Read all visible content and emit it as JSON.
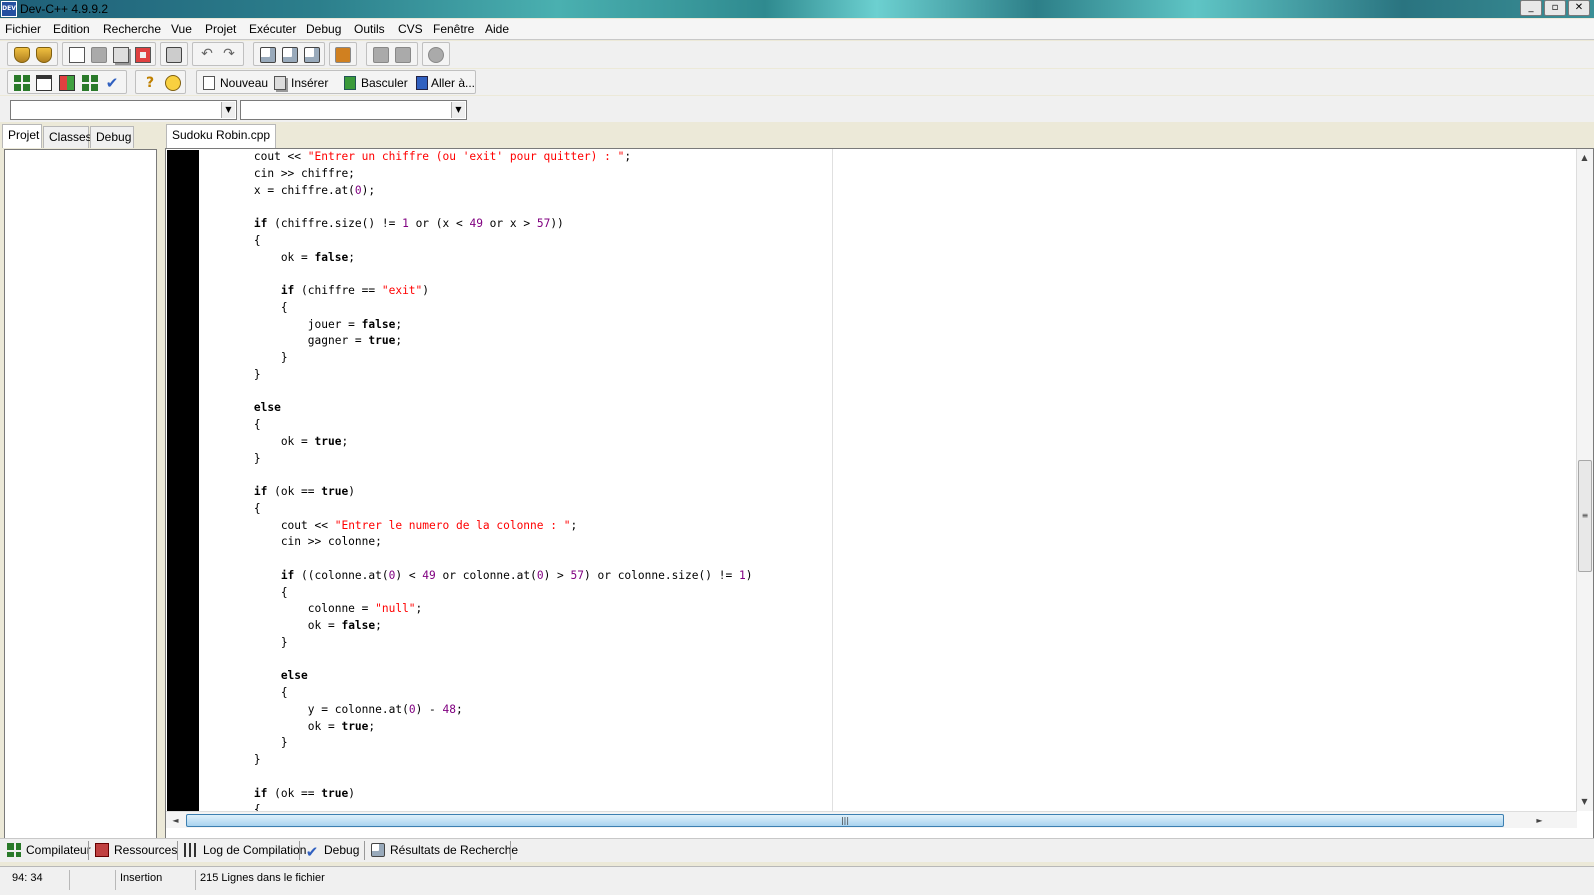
{
  "window": {
    "title": "Dev-C++ 4.9.9.2",
    "icon_label": "DEV",
    "minimize": "_",
    "maximize": "▫",
    "close": "✕"
  },
  "menu": [
    "Fichier",
    "Edition",
    "Recherche",
    "Vue",
    "Projet",
    "Exécuter",
    "Debug",
    "Outils",
    "CVS",
    "Fenêtre",
    "Aide"
  ],
  "toolbar": {
    "nouveau": "Nouveau",
    "inserer": "Insérer",
    "basculer": "Basculer",
    "aller": "Aller à..."
  },
  "combos": {
    "left_value": "",
    "right_value": "",
    "arrow": "▼"
  },
  "left_tabs": [
    "Projet",
    "Classes",
    "Debug"
  ],
  "file_tab": "Sudoku Robin.cpp",
  "code_lines": [
    [
      [
        "t",
        "        cout << "
      ],
      [
        "s",
        "\"Entrer un chiffre (ou 'exit' pour quitter) : \""
      ],
      [
        "t",
        ";"
      ]
    ],
    [
      [
        "t",
        "        cin >> chiffre;"
      ]
    ],
    [
      [
        "t",
        "        x = chiffre.at("
      ],
      [
        "n",
        "0"
      ],
      [
        "t",
        ");"
      ]
    ],
    [
      [
        "t",
        ""
      ]
    ],
    [
      [
        "k",
        "        if"
      ],
      [
        "t",
        " (chiffre.size() != "
      ],
      [
        "n",
        "1"
      ],
      [
        "t",
        " or (x < "
      ],
      [
        "n",
        "49"
      ],
      [
        "t",
        " or x > "
      ],
      [
        "n",
        "57"
      ],
      [
        "t",
        "))"
      ]
    ],
    [
      [
        "t",
        "        {"
      ]
    ],
    [
      [
        "t",
        "            ok = "
      ],
      [
        "k",
        "false"
      ],
      [
        "t",
        ";"
      ]
    ],
    [
      [
        "t",
        ""
      ]
    ],
    [
      [
        "k",
        "            if"
      ],
      [
        "t",
        " (chiffre == "
      ],
      [
        "s",
        "\"exit\""
      ],
      [
        "t",
        ")"
      ]
    ],
    [
      [
        "t",
        "            {"
      ]
    ],
    [
      [
        "t",
        "                jouer = "
      ],
      [
        "k",
        "false"
      ],
      [
        "t",
        ";"
      ]
    ],
    [
      [
        "t",
        "                gagner = "
      ],
      [
        "k",
        "true"
      ],
      [
        "t",
        ";"
      ]
    ],
    [
      [
        "t",
        "            }"
      ]
    ],
    [
      [
        "t",
        "        }"
      ]
    ],
    [
      [
        "t",
        ""
      ]
    ],
    [
      [
        "k",
        "        else"
      ]
    ],
    [
      [
        "t",
        "        {"
      ]
    ],
    [
      [
        "t",
        "            ok = "
      ],
      [
        "k",
        "true"
      ],
      [
        "t",
        ";"
      ]
    ],
    [
      [
        "t",
        "        }"
      ]
    ],
    [
      [
        "t",
        ""
      ]
    ],
    [
      [
        "k",
        "        if"
      ],
      [
        "t",
        " (ok == "
      ],
      [
        "k",
        "true"
      ],
      [
        "t",
        ")"
      ]
    ],
    [
      [
        "t",
        "        {"
      ]
    ],
    [
      [
        "t",
        "            cout << "
      ],
      [
        "s",
        "\"Entrer le numero de la colonne : \""
      ],
      [
        "t",
        ";"
      ]
    ],
    [
      [
        "t",
        "            cin >> colonne;"
      ]
    ],
    [
      [
        "t",
        ""
      ]
    ],
    [
      [
        "k",
        "            if"
      ],
      [
        "t",
        " ((colonne.at("
      ],
      [
        "n",
        "0"
      ],
      [
        "t",
        ") < "
      ],
      [
        "n",
        "49"
      ],
      [
        "t",
        " or colonne.at("
      ],
      [
        "n",
        "0"
      ],
      [
        "t",
        ") > "
      ],
      [
        "n",
        "57"
      ],
      [
        "t",
        ") or colonne.size() != "
      ],
      [
        "n",
        "1"
      ],
      [
        "t",
        ")"
      ]
    ],
    [
      [
        "t",
        "            {"
      ]
    ],
    [
      [
        "t",
        "                colonne = "
      ],
      [
        "s",
        "\"null\""
      ],
      [
        "t",
        ";"
      ]
    ],
    [
      [
        "t",
        "                ok = "
      ],
      [
        "k",
        "false"
      ],
      [
        "t",
        ";"
      ]
    ],
    [
      [
        "t",
        "            }"
      ]
    ],
    [
      [
        "t",
        ""
      ]
    ],
    [
      [
        "k",
        "            else"
      ]
    ],
    [
      [
        "t",
        "            {"
      ]
    ],
    [
      [
        "t",
        "                y = colonne.at("
      ],
      [
        "n",
        "0"
      ],
      [
        "t",
        ") - "
      ],
      [
        "n",
        "48"
      ],
      [
        "t",
        ";"
      ]
    ],
    [
      [
        "t",
        "                ok = "
      ],
      [
        "k",
        "true"
      ],
      [
        "t",
        ";"
      ]
    ],
    [
      [
        "t",
        "            }"
      ]
    ],
    [
      [
        "t",
        "        }"
      ]
    ],
    [
      [
        "t",
        ""
      ]
    ],
    [
      [
        "k",
        "        if"
      ],
      [
        "t",
        " (ok == "
      ],
      [
        "k",
        "true"
      ],
      [
        "t",
        ")"
      ]
    ],
    [
      [
        "t",
        "        {"
      ]
    ]
  ],
  "bottom_tabs": [
    "Compilateur",
    "Ressources",
    "Log de Compilation",
    "Debug",
    "Résultats de Recherche"
  ],
  "status": {
    "position": "94: 34",
    "empty": "",
    "mode": "Insertion",
    "lines": "215 Lignes dans le fichier"
  },
  "scroll": {
    "up": "▲",
    "down": "▼",
    "left": "◄",
    "right": "►",
    "grip_v": "≡",
    "grip_h": "|||"
  }
}
